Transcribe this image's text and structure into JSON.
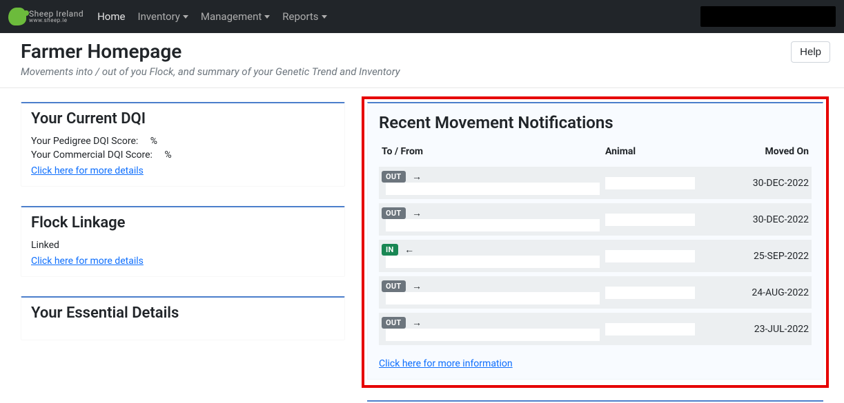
{
  "brand": {
    "main": "Sheep Ireland",
    "sub": "www.sheep.ie"
  },
  "nav": {
    "home": "Home",
    "inventory": "Inventory",
    "management": "Management",
    "reports": "Reports"
  },
  "header": {
    "title": "Farmer Homepage",
    "subtitle": "Movements into / out of you Flock, and summary of your Genetic Trend and Inventory",
    "help": "Help"
  },
  "dqi": {
    "title": "Your Current DQI",
    "pedigree_label": "Your Pedigree DQI Score:",
    "pedigree_value": "%",
    "commercial_label": "Your Commercial DQI Score:",
    "commercial_value": "%",
    "details_link": "Click here for more details"
  },
  "flock": {
    "title": "Flock Linkage",
    "status": "Linked",
    "details_link": "Click here for more details"
  },
  "essential": {
    "title": "Your Essential Details"
  },
  "movements": {
    "title": "Recent Movement Notifications",
    "col_tofrom": "To / From",
    "col_animal": "Animal",
    "col_moved": "Moved On",
    "rows": [
      {
        "dir": "OUT",
        "arrow": "→",
        "date": "30-DEC-2022"
      },
      {
        "dir": "OUT",
        "arrow": "→",
        "date": "30-DEC-2022"
      },
      {
        "dir": "IN",
        "arrow": "←",
        "date": "25-SEP-2022"
      },
      {
        "dir": "OUT",
        "arrow": "→",
        "date": "24-AUG-2022"
      },
      {
        "dir": "OUT",
        "arrow": "→",
        "date": "23-JUL-2022"
      }
    ],
    "more_link": "Click here for more information"
  }
}
